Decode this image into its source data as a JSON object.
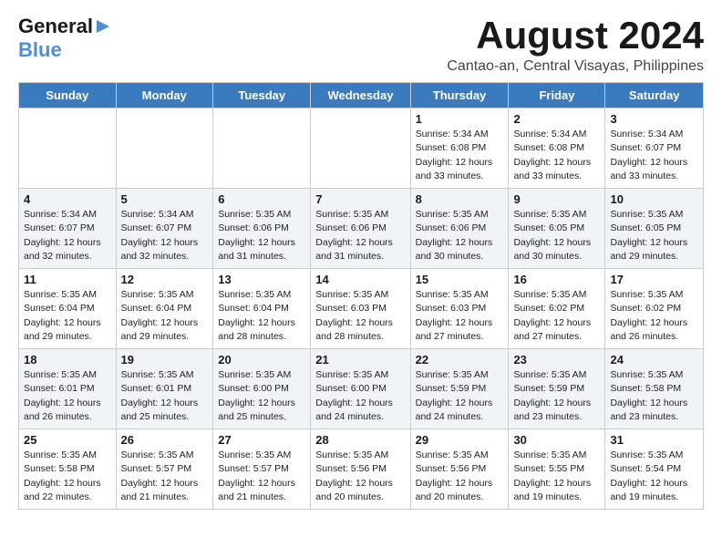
{
  "logo": {
    "general": "General",
    "blue": "Blue",
    "arrow": "▶"
  },
  "header": {
    "month": "August 2024",
    "location": "Cantao-an, Central Visayas, Philippines"
  },
  "weekdays": [
    "Sunday",
    "Monday",
    "Tuesday",
    "Wednesday",
    "Thursday",
    "Friday",
    "Saturday"
  ],
  "weeks": [
    [
      {
        "day": "",
        "info": ""
      },
      {
        "day": "",
        "info": ""
      },
      {
        "day": "",
        "info": ""
      },
      {
        "day": "",
        "info": ""
      },
      {
        "day": "1",
        "info": "Sunrise: 5:34 AM\nSunset: 6:08 PM\nDaylight: 12 hours\nand 33 minutes."
      },
      {
        "day": "2",
        "info": "Sunrise: 5:34 AM\nSunset: 6:08 PM\nDaylight: 12 hours\nand 33 minutes."
      },
      {
        "day": "3",
        "info": "Sunrise: 5:34 AM\nSunset: 6:07 PM\nDaylight: 12 hours\nand 33 minutes."
      }
    ],
    [
      {
        "day": "4",
        "info": "Sunrise: 5:34 AM\nSunset: 6:07 PM\nDaylight: 12 hours\nand 32 minutes."
      },
      {
        "day": "5",
        "info": "Sunrise: 5:34 AM\nSunset: 6:07 PM\nDaylight: 12 hours\nand 32 minutes."
      },
      {
        "day": "6",
        "info": "Sunrise: 5:35 AM\nSunset: 6:06 PM\nDaylight: 12 hours\nand 31 minutes."
      },
      {
        "day": "7",
        "info": "Sunrise: 5:35 AM\nSunset: 6:06 PM\nDaylight: 12 hours\nand 31 minutes."
      },
      {
        "day": "8",
        "info": "Sunrise: 5:35 AM\nSunset: 6:06 PM\nDaylight: 12 hours\nand 30 minutes."
      },
      {
        "day": "9",
        "info": "Sunrise: 5:35 AM\nSunset: 6:05 PM\nDaylight: 12 hours\nand 30 minutes."
      },
      {
        "day": "10",
        "info": "Sunrise: 5:35 AM\nSunset: 6:05 PM\nDaylight: 12 hours\nand 29 minutes."
      }
    ],
    [
      {
        "day": "11",
        "info": "Sunrise: 5:35 AM\nSunset: 6:04 PM\nDaylight: 12 hours\nand 29 minutes."
      },
      {
        "day": "12",
        "info": "Sunrise: 5:35 AM\nSunset: 6:04 PM\nDaylight: 12 hours\nand 29 minutes."
      },
      {
        "day": "13",
        "info": "Sunrise: 5:35 AM\nSunset: 6:04 PM\nDaylight: 12 hours\nand 28 minutes."
      },
      {
        "day": "14",
        "info": "Sunrise: 5:35 AM\nSunset: 6:03 PM\nDaylight: 12 hours\nand 28 minutes."
      },
      {
        "day": "15",
        "info": "Sunrise: 5:35 AM\nSunset: 6:03 PM\nDaylight: 12 hours\nand 27 minutes."
      },
      {
        "day": "16",
        "info": "Sunrise: 5:35 AM\nSunset: 6:02 PM\nDaylight: 12 hours\nand 27 minutes."
      },
      {
        "day": "17",
        "info": "Sunrise: 5:35 AM\nSunset: 6:02 PM\nDaylight: 12 hours\nand 26 minutes."
      }
    ],
    [
      {
        "day": "18",
        "info": "Sunrise: 5:35 AM\nSunset: 6:01 PM\nDaylight: 12 hours\nand 26 minutes."
      },
      {
        "day": "19",
        "info": "Sunrise: 5:35 AM\nSunset: 6:01 PM\nDaylight: 12 hours\nand 25 minutes."
      },
      {
        "day": "20",
        "info": "Sunrise: 5:35 AM\nSunset: 6:00 PM\nDaylight: 12 hours\nand 25 minutes."
      },
      {
        "day": "21",
        "info": "Sunrise: 5:35 AM\nSunset: 6:00 PM\nDaylight: 12 hours\nand 24 minutes."
      },
      {
        "day": "22",
        "info": "Sunrise: 5:35 AM\nSunset: 5:59 PM\nDaylight: 12 hours\nand 24 minutes."
      },
      {
        "day": "23",
        "info": "Sunrise: 5:35 AM\nSunset: 5:59 PM\nDaylight: 12 hours\nand 23 minutes."
      },
      {
        "day": "24",
        "info": "Sunrise: 5:35 AM\nSunset: 5:58 PM\nDaylight: 12 hours\nand 23 minutes."
      }
    ],
    [
      {
        "day": "25",
        "info": "Sunrise: 5:35 AM\nSunset: 5:58 PM\nDaylight: 12 hours\nand 22 minutes."
      },
      {
        "day": "26",
        "info": "Sunrise: 5:35 AM\nSunset: 5:57 PM\nDaylight: 12 hours\nand 21 minutes."
      },
      {
        "day": "27",
        "info": "Sunrise: 5:35 AM\nSunset: 5:57 PM\nDaylight: 12 hours\nand 21 minutes."
      },
      {
        "day": "28",
        "info": "Sunrise: 5:35 AM\nSunset: 5:56 PM\nDaylight: 12 hours\nand 20 minutes."
      },
      {
        "day": "29",
        "info": "Sunrise: 5:35 AM\nSunset: 5:56 PM\nDaylight: 12 hours\nand 20 minutes."
      },
      {
        "day": "30",
        "info": "Sunrise: 5:35 AM\nSunset: 5:55 PM\nDaylight: 12 hours\nand 19 minutes."
      },
      {
        "day": "31",
        "info": "Sunrise: 5:35 AM\nSunset: 5:54 PM\nDaylight: 12 hours\nand 19 minutes."
      }
    ]
  ]
}
